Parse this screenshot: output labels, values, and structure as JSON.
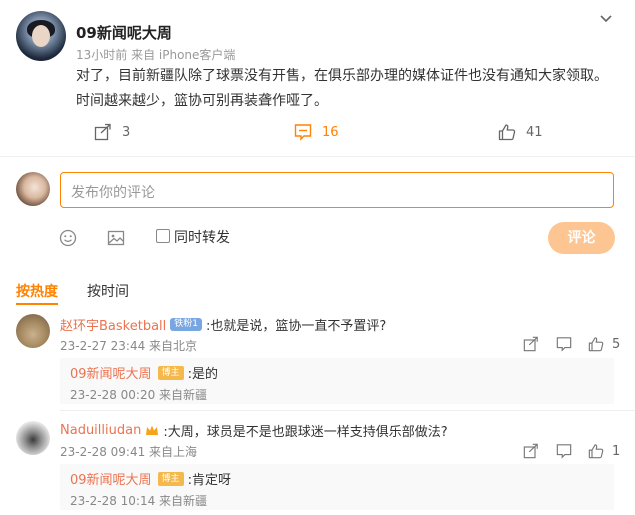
{
  "post": {
    "author": "09新闻呢大周",
    "meta": "13小时前 来自 iPhone客户端",
    "text_line1": "对了，目前新疆队除了球票没有开售，在俱乐部办理的媒体证件也没有通知大家领取。",
    "text_line2": "时间越来越少，篮协可别再装聋作哑了。",
    "actions": {
      "repost_count": "3",
      "comment_count": "16",
      "like_count": "41"
    }
  },
  "composer": {
    "placeholder": "发布你的评论",
    "repost_checkbox_label": "同时转发",
    "submit_label": "评论"
  },
  "sort": {
    "hot_label": "按热度",
    "time_label": "按时间"
  },
  "comments": [
    {
      "username": "赵环宇Basketball",
      "badge": "铁粉1",
      "text": ":也就是说，篮协一直不予置评?",
      "meta": "23-2-27 23:44 来自北京",
      "like_count": "5",
      "reply": {
        "username": "09新闻呢大周",
        "badge": "博主",
        "text": ":是的",
        "meta": "23-2-28 00:20 来自新疆"
      }
    },
    {
      "username": "Naduilliudan",
      "text": ":大周，球员是不是也跟球迷一样支持俱乐部做法?",
      "meta": "23-2-28 09:41 来自上海",
      "like_count": "1",
      "reply": {
        "username": "09新闻呢大周",
        "badge": "博主",
        "text": ":肯定呀",
        "meta": "23-2-28 10:14 来自新疆"
      }
    }
  ],
  "colors": {
    "accent": "#ff8200",
    "username": "#eb7350",
    "submit_disabled": "#fdc592"
  },
  "icons": [
    "chevron-down-icon",
    "repost-icon",
    "comment-icon",
    "like-icon",
    "emoji-icon",
    "image-icon",
    "crown-icon",
    "reply-icon",
    "more-icon"
  ]
}
